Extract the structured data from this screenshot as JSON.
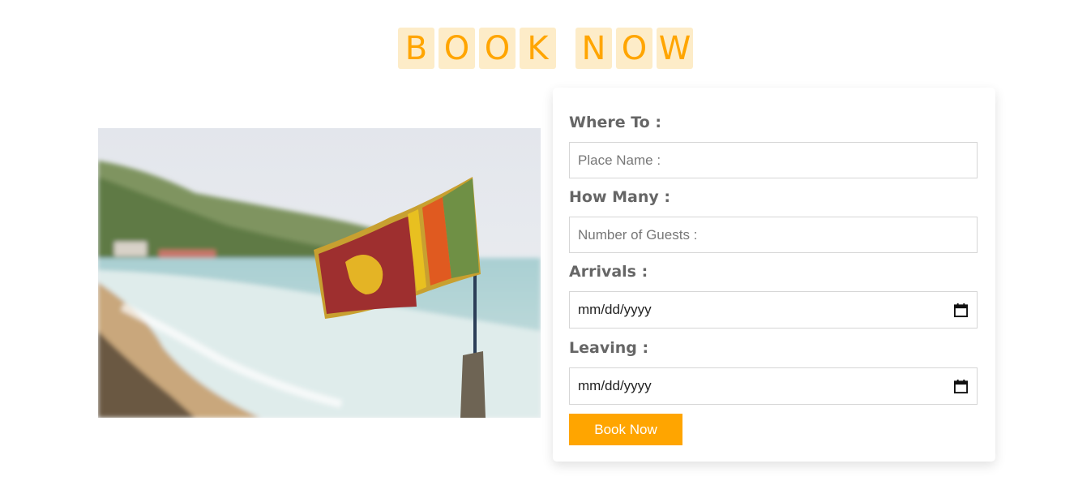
{
  "heading": {
    "words": [
      [
        "B",
        "O",
        "O",
        "K"
      ],
      [
        "N",
        "O",
        "W"
      ]
    ]
  },
  "image": {
    "alt": "Sri Lanka flag on a beach"
  },
  "form": {
    "where_label": "Where To :",
    "place_placeholder": "Place Name :",
    "how_many_label": "How Many :",
    "guests_placeholder": "Number of Guests :",
    "arrivals_label": "Arrivals :",
    "arrivals_value": "mm/dd/yyyy",
    "leaving_label": "Leaving :",
    "leaving_value": "mm/dd/yyyy",
    "submit_label": "Book Now"
  },
  "icons": {
    "date_picker": "calendar-icon"
  },
  "colors": {
    "accent": "#ffa500",
    "tile_bg": "#fdecc8",
    "label": "#666666"
  }
}
